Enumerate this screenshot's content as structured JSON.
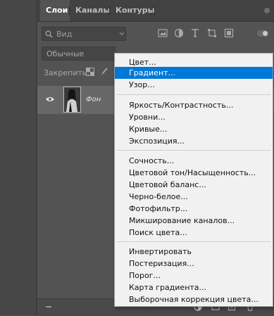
{
  "colors": {
    "accent": "#0078d7",
    "panel": "#535353",
    "menu_bg": "#f1f1f1"
  },
  "tabs": [
    {
      "label": "Слои",
      "active": true
    },
    {
      "label": "Каналы",
      "active": false
    },
    {
      "label": "Контуры",
      "active": false
    }
  ],
  "filter": {
    "label": "Вид"
  },
  "blend": {
    "mode": "Обычные"
  },
  "lock": {
    "label": "Закрепить:"
  },
  "layer": {
    "name": "Фон"
  },
  "menu": {
    "groups": [
      [
        "Цвет...",
        "Градиент...",
        "Узор..."
      ],
      [
        "Яркость/Контрастность...",
        "Уровни...",
        "Кривые...",
        "Экспозиция..."
      ],
      [
        "Сочность...",
        "Цветовой тон/Насыщенность...",
        "Цветовой баланс...",
        "Черно-белое...",
        "Фотофильтр...",
        "Микширование каналов...",
        "Поиск цвета..."
      ],
      [
        "Инвертировать",
        "Постеризация...",
        "Порог...",
        "Карта градиента...",
        "Выборочная коррекция цвета..."
      ]
    ],
    "highlighted": "Градиент..."
  }
}
